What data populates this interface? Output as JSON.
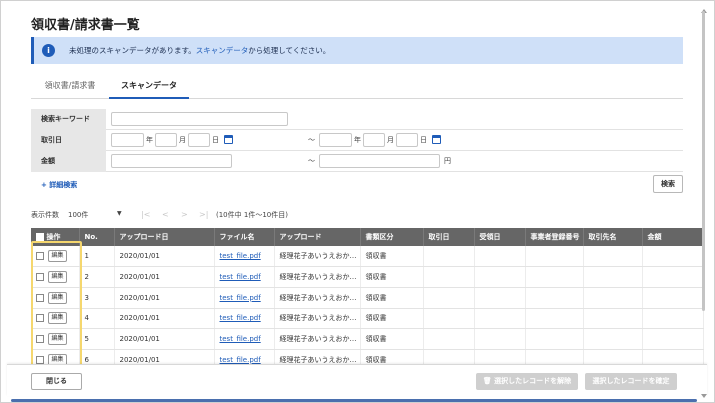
{
  "page": {
    "title": "領収書/請求書一覧"
  },
  "notice": {
    "icon": "info-icon",
    "text_before": "未処理のスキャンデータがあります。",
    "link": "スキャンデータ",
    "text_after": "から処理してください。"
  },
  "tabs": [
    {
      "label": "領収書/請求書",
      "active": false
    },
    {
      "label": "スキャンデータ",
      "active": true
    }
  ],
  "search": {
    "keyword_label": "検索キーワード",
    "keyword_value": "",
    "date_label": "取引日",
    "amount_label": "金額",
    "year_unit": "年",
    "month_unit": "月",
    "day_unit": "日",
    "range_sep": "〜",
    "yen_unit": "円",
    "advanced_link": "+ 詳細検索",
    "search_button": "検索"
  },
  "pager": {
    "per_page_label": "表示件数",
    "per_page_value": "100件",
    "first": "|<",
    "prev": "<",
    "next": ">",
    "last": ">|",
    "summary": "(10件中 1件〜10件目)"
  },
  "table": {
    "headers": [
      "操作",
      "No.",
      "アップロード日",
      "ファイル名",
      "アップロード",
      "書類区分",
      "取引日",
      "受領日",
      "事業者登録番号",
      "取引先名",
      "金額"
    ],
    "edit_label": "編集",
    "rows": [
      {
        "no": "1",
        "date": "2020/01/01",
        "file": "test_file.pdf",
        "uploader": "経理花子あいうえおか…",
        "type": "領収書"
      },
      {
        "no": "2",
        "date": "2020/01/01",
        "file": "test_file.pdf",
        "uploader": "経理花子あいうえおか…",
        "type": "領収書"
      },
      {
        "no": "3",
        "date": "2020/01/01",
        "file": "test_file.pdf",
        "uploader": "経理花子あいうえおか…",
        "type": "領収書"
      },
      {
        "no": "4",
        "date": "2020/01/01",
        "file": "test_file.pdf",
        "uploader": "経理花子あいうえおか…",
        "type": "領収書"
      },
      {
        "no": "5",
        "date": "2020/01/01",
        "file": "test_file.pdf",
        "uploader": "経理花子あいうえおか…",
        "type": "領収書"
      },
      {
        "no": "6",
        "date": "2020/01/01",
        "file": "test_file.pdf",
        "uploader": "経理花子あいうえおか…",
        "type": "領収書"
      }
    ]
  },
  "footer": {
    "close_button": "閉じる",
    "release_button": "選択したレコードを解除",
    "confirm_button": "選択したレコードを確定"
  },
  "colors": {
    "accent": "#1f5cb8",
    "notice_bg": "#cfe0f8",
    "table_header": "#666666",
    "highlight": "#f5d76e"
  }
}
